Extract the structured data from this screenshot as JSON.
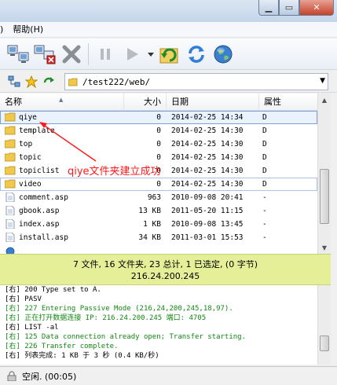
{
  "menubar": {
    "items": [
      "帮助(H)"
    ],
    "partial_left": ")"
  },
  "address": {
    "path": "/test222/web/"
  },
  "columns": {
    "name": "名称",
    "size": "大小",
    "date": "日期",
    "attr": "属性"
  },
  "files": [
    {
      "name": "qiye",
      "size": "0",
      "date": "2014-02-25 14:34",
      "attr": "D",
      "type": "folder"
    },
    {
      "name": "template",
      "size": "0",
      "date": "2014-02-25 14:30",
      "attr": "D",
      "type": "folder"
    },
    {
      "name": "top",
      "size": "0",
      "date": "2014-02-25 14:30",
      "attr": "D",
      "type": "folder"
    },
    {
      "name": "topic",
      "size": "0",
      "date": "2014-02-25 14:30",
      "attr": "D",
      "type": "folder"
    },
    {
      "name": "topiclist",
      "size": "0",
      "date": "2014-02-25 14:30",
      "attr": "D",
      "type": "folder"
    },
    {
      "name": "video",
      "size": "0",
      "date": "2014-02-25 14:30",
      "attr": "D",
      "type": "folder"
    },
    {
      "name": "comment.asp",
      "size": "963",
      "date": "2010-09-08 20:41",
      "attr": "-",
      "type": "file"
    },
    {
      "name": "gbook.asp",
      "size": "13 KB",
      "date": "2011-05-20 11:15",
      "attr": "-",
      "type": "file"
    },
    {
      "name": "index.asp",
      "size": "1 KB",
      "date": "2010-09-08 13:45",
      "attr": "-",
      "type": "file"
    },
    {
      "name": "install.asp",
      "size": "34 KB",
      "date": "2011-03-01 15:53",
      "attr": "-",
      "type": "file"
    },
    {
      "name": "",
      "size": "",
      "date": "",
      "attr": "",
      "type": "file"
    }
  ],
  "summary": {
    "line1": "7 文件, 16 文件夹, 23 总计, 1 已选定, (0 字节)",
    "line2": "216.24.200.245"
  },
  "log": [
    {
      "text": "[右] 200 Type set to A.",
      "color": "black"
    },
    {
      "text": "[右] PASV",
      "color": "black"
    },
    {
      "text": "[右] 227 Entering Passive Mode (216,24,200,245,18,97).",
      "color": "green"
    },
    {
      "text": "[右] 正在打开数据连接 IP: 216.24.200.245 端口: 4705",
      "color": "green"
    },
    {
      "text": "[右] LIST -al",
      "color": "black"
    },
    {
      "text": "[右] 125 Data connection already open; Transfer starting.",
      "color": "green"
    },
    {
      "text": "[右] 226 Transfer complete.",
      "color": "green"
    },
    {
      "text": "[右] 列表完成: 1 KB 于 3 秒 (0.4 KB/秒)",
      "color": "black"
    }
  ],
  "status": {
    "text": "空闲. (00:05)"
  },
  "annotation": {
    "text": "qiye文件夹建立成功",
    "color": "#ff1a1a"
  },
  "colors": {
    "summary_bg": "#e4ef97",
    "selection": "#eaf3fd",
    "log_green": "#118811"
  }
}
